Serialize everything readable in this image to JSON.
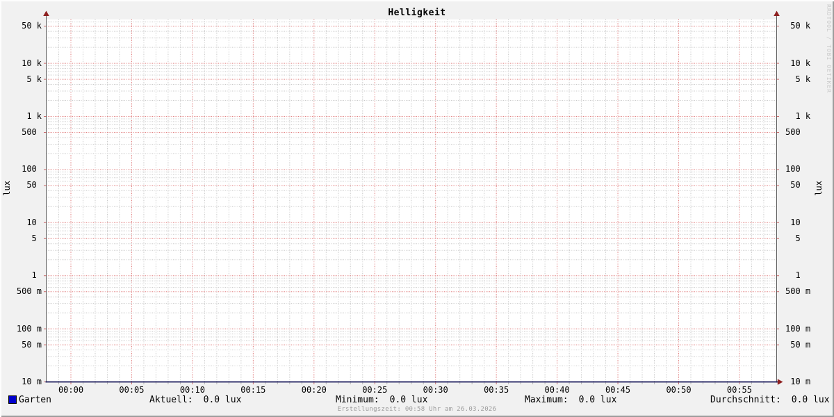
{
  "watermark": "RRDTOOL / TOBI OETIKER",
  "footer": {
    "creation_text": "Erstellungszeit: 00:58 Uhr am 26.03.2026"
  },
  "legend": {
    "series": {
      "label": "Garten",
      "swatch_color": "#0000cc"
    },
    "stats": [
      {
        "label": "Aktuell:",
        "value": "0.0 lux"
      },
      {
        "label": "Minimum:",
        "value": "0.0 lux"
      },
      {
        "label": "Maximum:",
        "value": "0.0 lux"
      },
      {
        "label": "Durchschnitt:",
        "value": "0.0 lux"
      }
    ]
  },
  "chart_data": {
    "type": "line",
    "title": "Helligkeit",
    "ylabel": "lux",
    "ylabel_right": "lux",
    "xlabel": "",
    "y_scale": "logarithmic",
    "ylim": [
      0.01,
      60000
    ],
    "grid": {
      "on": true,
      "major_color": "#e07d7d",
      "minor_color": "#c9c9c9",
      "major_x_every_min": 5,
      "minor_x_every_min": 1
    },
    "canvas_color": "#ffffff",
    "background_color": "#f1f1f1",
    "axis_color": "#17175a",
    "arrow_color": "#8e2020",
    "legend_position": "bottom-left",
    "x_ticks": [
      {
        "label": "00:00",
        "minute": 0
      },
      {
        "label": "00:05",
        "minute": 5
      },
      {
        "label": "00:10",
        "minute": 10
      },
      {
        "label": "00:15",
        "minute": 15
      },
      {
        "label": "00:20",
        "minute": 20
      },
      {
        "label": "00:25",
        "minute": 25
      },
      {
        "label": "00:30",
        "minute": 30
      },
      {
        "label": "00:35",
        "minute": 35
      },
      {
        "label": "00:40",
        "minute": 40
      },
      {
        "label": "00:45",
        "minute": 45
      },
      {
        "label": "00:50",
        "minute": 50
      },
      {
        "label": "00:55",
        "minute": 55
      }
    ],
    "y_ticks": [
      {
        "label": "50 k",
        "value": 50000
      },
      {
        "label": "10 k",
        "value": 10000
      },
      {
        "label": "5 k",
        "value": 5000
      },
      {
        "label": "1 k",
        "value": 1000
      },
      {
        "label": "500",
        "value": 500
      },
      {
        "label": "100",
        "value": 100
      },
      {
        "label": "50",
        "value": 50
      },
      {
        "label": "10",
        "value": 10
      },
      {
        "label": "5",
        "value": 5
      },
      {
        "label": "1",
        "value": 1
      },
      {
        "label": "500 m",
        "value": 0.5
      },
      {
        "label": "100 m",
        "value": 0.1
      },
      {
        "label": "50 m",
        "value": 0.05
      },
      {
        "label": "10 m",
        "value": 0.01
      }
    ],
    "series": [
      {
        "name": "Garten",
        "color": "#0000cc",
        "x": [
          "00:00",
          "00:05",
          "00:10",
          "00:15",
          "00:20",
          "00:25",
          "00:30",
          "00:35",
          "00:40",
          "00:45",
          "00:50",
          "00:55"
        ],
        "values": [
          0,
          0,
          0,
          0,
          0,
          0,
          0,
          0,
          0,
          0,
          0,
          0
        ],
        "stats": {
          "current": 0.0,
          "min": 0.0,
          "max": 0.0,
          "avg": 0.0,
          "unit": "lux"
        }
      }
    ]
  }
}
